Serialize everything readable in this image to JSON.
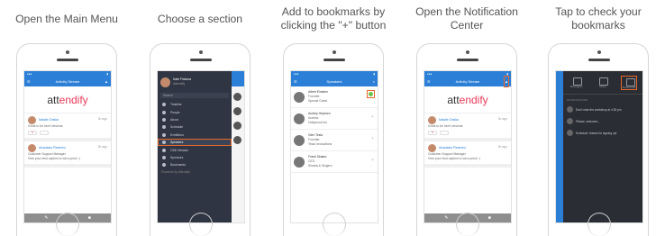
{
  "steps": [
    {
      "caption": "Open the Main Menu"
    },
    {
      "caption": "Choose a section"
    },
    {
      "caption": "Add to bookmarks by clicking the \"+\" button"
    },
    {
      "caption": "Open the Notification Center"
    },
    {
      "caption": "Tap to check your bookmarks"
    }
  ],
  "feed": {
    "title": "Activity Stream",
    "logo_a": "att",
    "logo_b": "endify",
    "posts": [
      {
        "name": "Natalie Dinklar",
        "text": "Great to be here! #events",
        "time": "3h ago"
      },
      {
        "name": "Anastasia Piesenko",
        "role": "Customer Support Manager",
        "org": "Attendify",
        "text": "Give your best caption to win a prize :)",
        "time": "3h ago"
      }
    ]
  },
  "drawer": {
    "user": "Kate Firstova",
    "org": "Attendify",
    "search": "Search",
    "items": [
      "Timeline",
      "People",
      "About",
      "Schedule",
      "Exhibitors",
      "Speakers",
      "CBD Session",
      "Sponsors",
      "Bookmarks"
    ],
    "selected_index": 5,
    "footer": "Powered by Attendify"
  },
  "speakers": {
    "title": "Speakers",
    "rows": [
      {
        "name": "Albert Einstein",
        "sub": "Founder",
        "sub2": "Special Guest"
      },
      {
        "name": "Audrey Hepburn",
        "sub": "Actress",
        "sub2": "Hollywood Inc"
      },
      {
        "name": "Glen Tesla",
        "sub": "Founder",
        "sub2": "Tesla Innovations"
      },
      {
        "name": "Frank Sinatra",
        "sub": "CEO",
        "sub2": "Sinatra & Singers"
      }
    ]
  },
  "notifications": {
    "tabs": [
      "Messages",
      "News",
      "Bookmarks"
    ],
    "header": "NOTIFICATIONS",
    "items": [
      "Don't miss the workshop at 4:30 pm",
      "Please, welcome...",
      "Schedule: thanks for signing up!"
    ]
  }
}
